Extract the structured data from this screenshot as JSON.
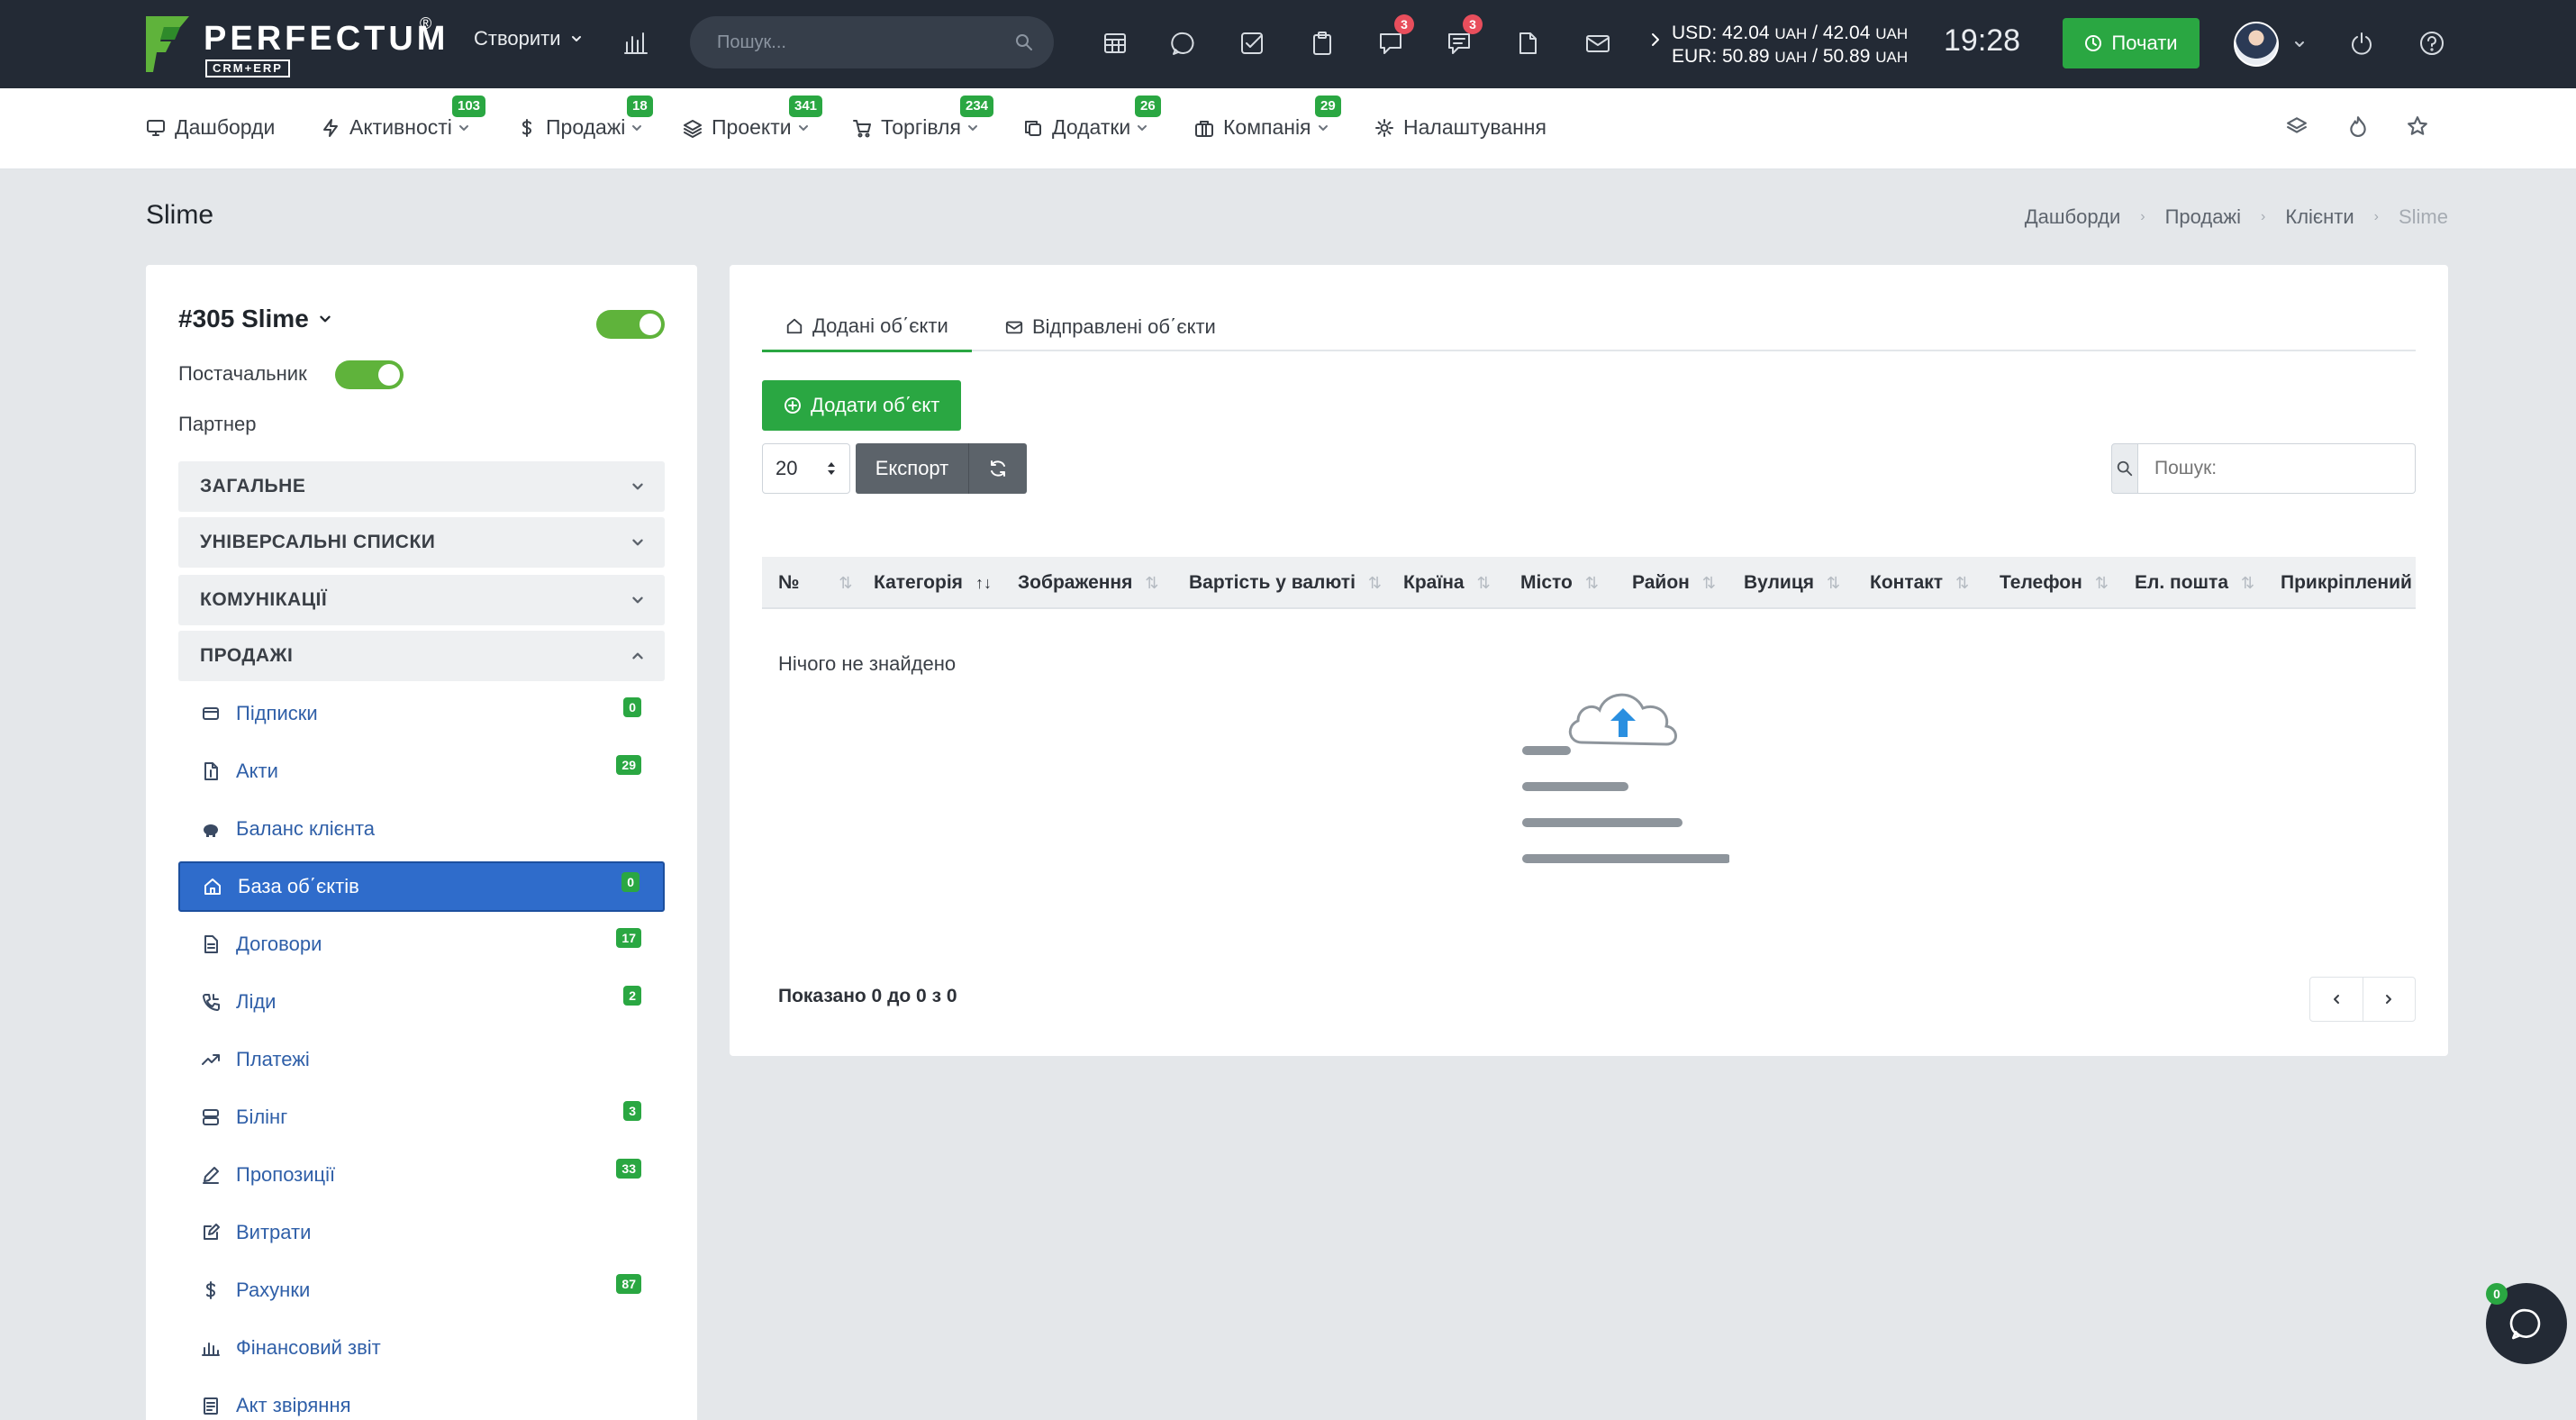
{
  "topbar": {
    "brand": "PERFECTUM",
    "brand_reg": "®",
    "brand_sub": "CRM+ERP",
    "create_label": "Створити",
    "search_placeholder": "Пошук...",
    "badges": {
      "notifications": "3",
      "messages": "3"
    },
    "currency": {
      "usd_label": "USD: 42.04",
      "usd_u1": "UAH",
      "usd_mid": " / 42.04",
      "usd_u2": "UAH",
      "eur_label": "EUR: 50.89",
      "eur_u1": "UAH",
      "eur_mid": " / 50.89",
      "eur_u2": "UAH"
    },
    "time": "19:28",
    "start_label": "Почати"
  },
  "nav": {
    "items": [
      {
        "label": "Дашборди",
        "icon": "monitor-icon",
        "badge": ""
      },
      {
        "label": "Активності",
        "icon": "bolt-icon",
        "badge": "103"
      },
      {
        "label": "Продажі",
        "icon": "dollar-icon",
        "badge": "18"
      },
      {
        "label": "Проекти",
        "icon": "layers-icon",
        "badge": "341"
      },
      {
        "label": "Торгівля",
        "icon": "cart-icon",
        "badge": "234"
      },
      {
        "label": "Додатки",
        "icon": "copy-icon",
        "badge": "26"
      },
      {
        "label": "Компанія",
        "icon": "briefcase-icon",
        "badge": "29"
      },
      {
        "label": "Налаштування",
        "icon": "gear-icon",
        "badge": ""
      }
    ]
  },
  "page": {
    "title": "Slime",
    "breadcrumb": [
      "Дашборди",
      "Продажі",
      "Клієнти",
      "Slime"
    ]
  },
  "client": {
    "name": "#305 Slime",
    "supplier_label": "Постачальник",
    "partner_label": "Партнер",
    "sections": [
      "ЗАГАЛЬНЕ",
      "УНІВЕРСАЛЬНІ СПИСКИ",
      "КОМУНІКАЦІЇ",
      "ПРОДАЖІ"
    ],
    "menu": [
      {
        "label": "Підписки",
        "count": "0"
      },
      {
        "label": "Акти",
        "count": "29"
      },
      {
        "label": "Баланс клієнта",
        "count": ""
      },
      {
        "label": "База об΄єктів",
        "count": "0"
      },
      {
        "label": "Договори",
        "count": "17"
      },
      {
        "label": "Ліди",
        "count": "2"
      },
      {
        "label": "Платежі",
        "count": ""
      },
      {
        "label": "Білінг",
        "count": "3"
      },
      {
        "label": "Пропозиції",
        "count": "33"
      },
      {
        "label": "Витрати",
        "count": ""
      },
      {
        "label": "Рахунки",
        "count": "87"
      },
      {
        "label": "Фінансовий звіт",
        "count": ""
      },
      {
        "label": "Акт звіряння",
        "count": ""
      }
    ]
  },
  "main": {
    "tabs": [
      "Додані об΄єкти",
      "Відправлені об΄єкти"
    ],
    "add_label": "Додати об΄єкт",
    "page_size": "20",
    "export_label": "Експорт",
    "search_placeholder": "Пошук:",
    "columns": [
      "№",
      "Категорія",
      "Зображення",
      "Вартість у валюті",
      "Країна",
      "Місто",
      "Район",
      "Вулиця",
      "Контакт",
      "Телефон",
      "Ел. пошта",
      "Прикріплений до"
    ],
    "empty_text": "Нічого не знайдено",
    "shown_text": "Показано 0 до 0 з 0"
  },
  "chat": {
    "count": "0"
  },
  "colors": {
    "accent_green": "#2aa742",
    "active_blue": "#2f6ccb",
    "topbar": "#232a35",
    "badge_red": "#e84e5c"
  }
}
